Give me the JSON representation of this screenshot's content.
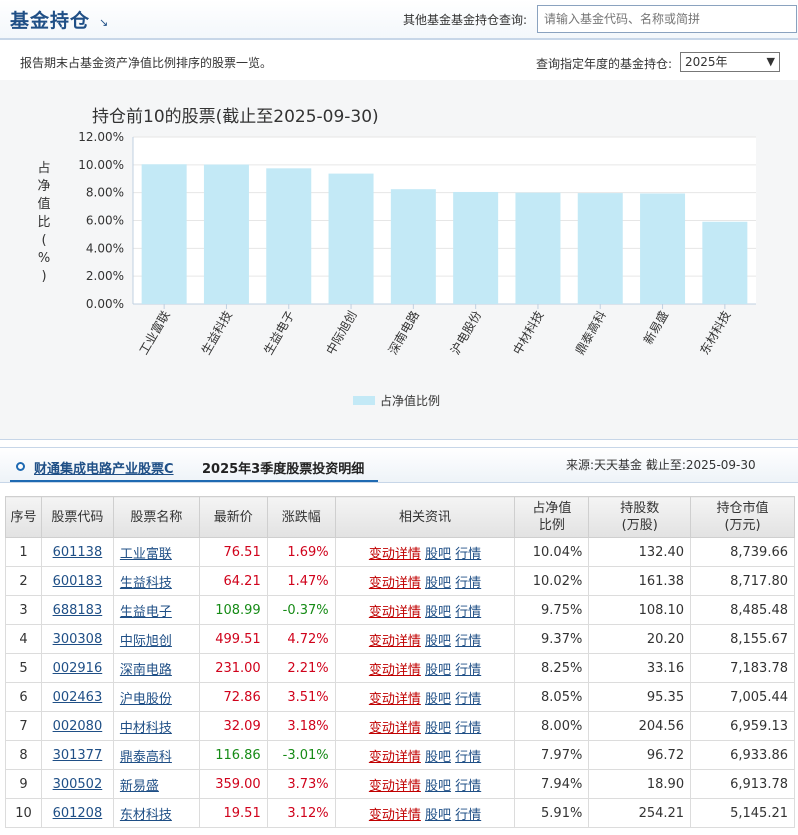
{
  "header": {
    "title": "基金持仓",
    "other_query_label": "其他基金基金持仓查询:",
    "search_placeholder": "请输入基金代码、名称或简拼"
  },
  "subheader": {
    "description": "报告期末占基金资产净值比例排序的股票一览。",
    "year_label": "查询指定年度的基金持仓:",
    "year_selected": "2025年"
  },
  "chart_data": {
    "type": "bar",
    "title": "持仓前10的股票(截止至2025-09-30)",
    "ylabel": "占净值比(%)",
    "ylim": [
      0,
      12
    ],
    "yticks": [
      "0.00%",
      "2.00%",
      "4.00%",
      "6.00%",
      "8.00%",
      "10.00%",
      "12.00%"
    ],
    "categories": [
      "工业富联",
      "生益科技",
      "生益电子",
      "中际旭创",
      "深南电路",
      "沪电股份",
      "中材科技",
      "鼎泰高科",
      "新易盛",
      "东材科技"
    ],
    "series": [
      {
        "name": "占净值比例",
        "values": [
          10.04,
          10.02,
          9.75,
          9.37,
          8.25,
          8.05,
          8.0,
          7.97,
          7.94,
          5.91
        ]
      }
    ],
    "grid": true,
    "legend": "bottom-center",
    "bar_color": "#c3e9f6"
  },
  "section": {
    "fund_name": "财通集成电路产业股票C",
    "title": "2025年3季度股票投资明细",
    "source": "来源:天天基金 截止至:2025-09-30"
  },
  "table": {
    "headers": {
      "seq": "序号",
      "code": "股票代码",
      "name": "股票名称",
      "price": "最新价",
      "change": "涨跌幅",
      "info": "相关资讯",
      "ratio_1": "占净值",
      "ratio_2": "比例",
      "shares_1": "持股数",
      "shares_2": "(万股)",
      "value_1": "持仓市值",
      "value_2": "(万元)"
    },
    "link_labels": {
      "detail": "变动详情",
      "forum": "股吧",
      "quote": "行情"
    },
    "rows": [
      {
        "seq": "1",
        "code": "601138",
        "name": "工业富联",
        "price": "76.51",
        "change": "1.69%",
        "dir": "up",
        "ratio": "10.04%",
        "shares": "132.40",
        "value": "8,739.66"
      },
      {
        "seq": "2",
        "code": "600183",
        "name": "生益科技",
        "price": "64.21",
        "change": "1.47%",
        "dir": "up",
        "ratio": "10.02%",
        "shares": "161.38",
        "value": "8,717.80"
      },
      {
        "seq": "3",
        "code": "688183",
        "name": "生益电子",
        "price": "108.99",
        "change": "-0.37%",
        "dir": "down",
        "ratio": "9.75%",
        "shares": "108.10",
        "value": "8,485.48"
      },
      {
        "seq": "4",
        "code": "300308",
        "name": "中际旭创",
        "price": "499.51",
        "change": "4.72%",
        "dir": "up",
        "ratio": "9.37%",
        "shares": "20.20",
        "value": "8,155.67"
      },
      {
        "seq": "5",
        "code": "002916",
        "name": "深南电路",
        "price": "231.00",
        "change": "2.21%",
        "dir": "up",
        "ratio": "8.25%",
        "shares": "33.16",
        "value": "7,183.78"
      },
      {
        "seq": "6",
        "code": "002463",
        "name": "沪电股份",
        "price": "72.86",
        "change": "3.51%",
        "dir": "up",
        "ratio": "8.05%",
        "shares": "95.35",
        "value": "7,005.44"
      },
      {
        "seq": "7",
        "code": "002080",
        "name": "中材科技",
        "price": "32.09",
        "change": "3.18%",
        "dir": "up",
        "ratio": "8.00%",
        "shares": "204.56",
        "value": "6,959.13"
      },
      {
        "seq": "8",
        "code": "301377",
        "name": "鼎泰高科",
        "price": "116.86",
        "change": "-3.01%",
        "dir": "down",
        "ratio": "7.97%",
        "shares": "96.72",
        "value": "6,933.86"
      },
      {
        "seq": "9",
        "code": "300502",
        "name": "新易盛",
        "price": "359.00",
        "change": "3.73%",
        "dir": "up",
        "ratio": "7.94%",
        "shares": "18.90",
        "value": "6,913.78"
      },
      {
        "seq": "10",
        "code": "601208",
        "name": "东材科技",
        "price": "19.51",
        "change": "3.12%",
        "dir": "up",
        "ratio": "5.91%",
        "shares": "254.21",
        "value": "5,145.21"
      }
    ]
  }
}
